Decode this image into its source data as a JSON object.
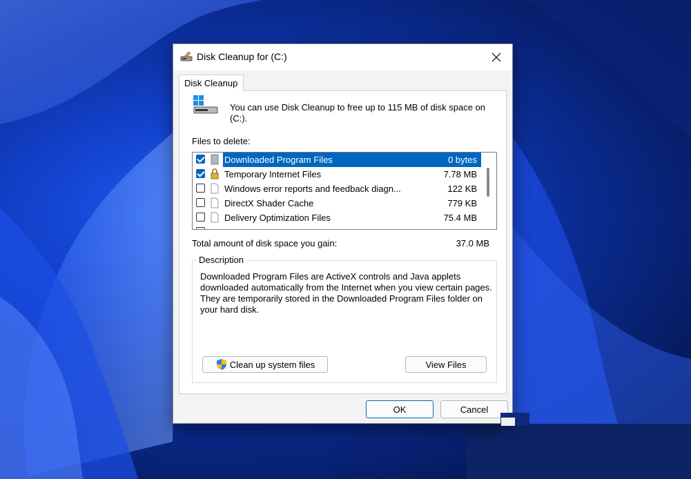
{
  "window": {
    "title": "Disk Cleanup for  (C:)"
  },
  "tab": {
    "label": "Disk Cleanup"
  },
  "info": {
    "text": "You can use Disk Cleanup to free up to 115 MB of disk space on (C:)."
  },
  "files": {
    "label": "Files to delete:",
    "items": [
      {
        "name": "Downloaded Program Files",
        "size": "0 bytes",
        "checked": true,
        "selected": true,
        "icon": "folder-icon"
      },
      {
        "name": "Temporary Internet Files",
        "size": "7.78 MB",
        "checked": true,
        "selected": false,
        "icon": "lock-icon"
      },
      {
        "name": "Windows error reports and feedback diagn...",
        "size": "122 KB",
        "checked": false,
        "selected": false,
        "icon": "file-icon"
      },
      {
        "name": "DirectX Shader Cache",
        "size": "779 KB",
        "checked": false,
        "selected": false,
        "icon": "file-icon"
      },
      {
        "name": "Delivery Optimization Files",
        "size": "75.4 MB",
        "checked": false,
        "selected": false,
        "icon": "file-icon"
      }
    ]
  },
  "total": {
    "label": "Total amount of disk space you gain:",
    "value": "37.0 MB"
  },
  "description": {
    "legend": "Description",
    "text": "Downloaded Program Files are ActiveX controls and Java applets downloaded automatically from the Internet when you view certain pages. They are temporarily stored in the Downloaded Program Files folder on your hard disk."
  },
  "buttons": {
    "cleanup_system": "Clean up system files",
    "view_files": "View Files",
    "ok": "OK",
    "cancel": "Cancel"
  },
  "colors": {
    "accent": "#0067c0",
    "wallpaper": "#1240c9"
  }
}
